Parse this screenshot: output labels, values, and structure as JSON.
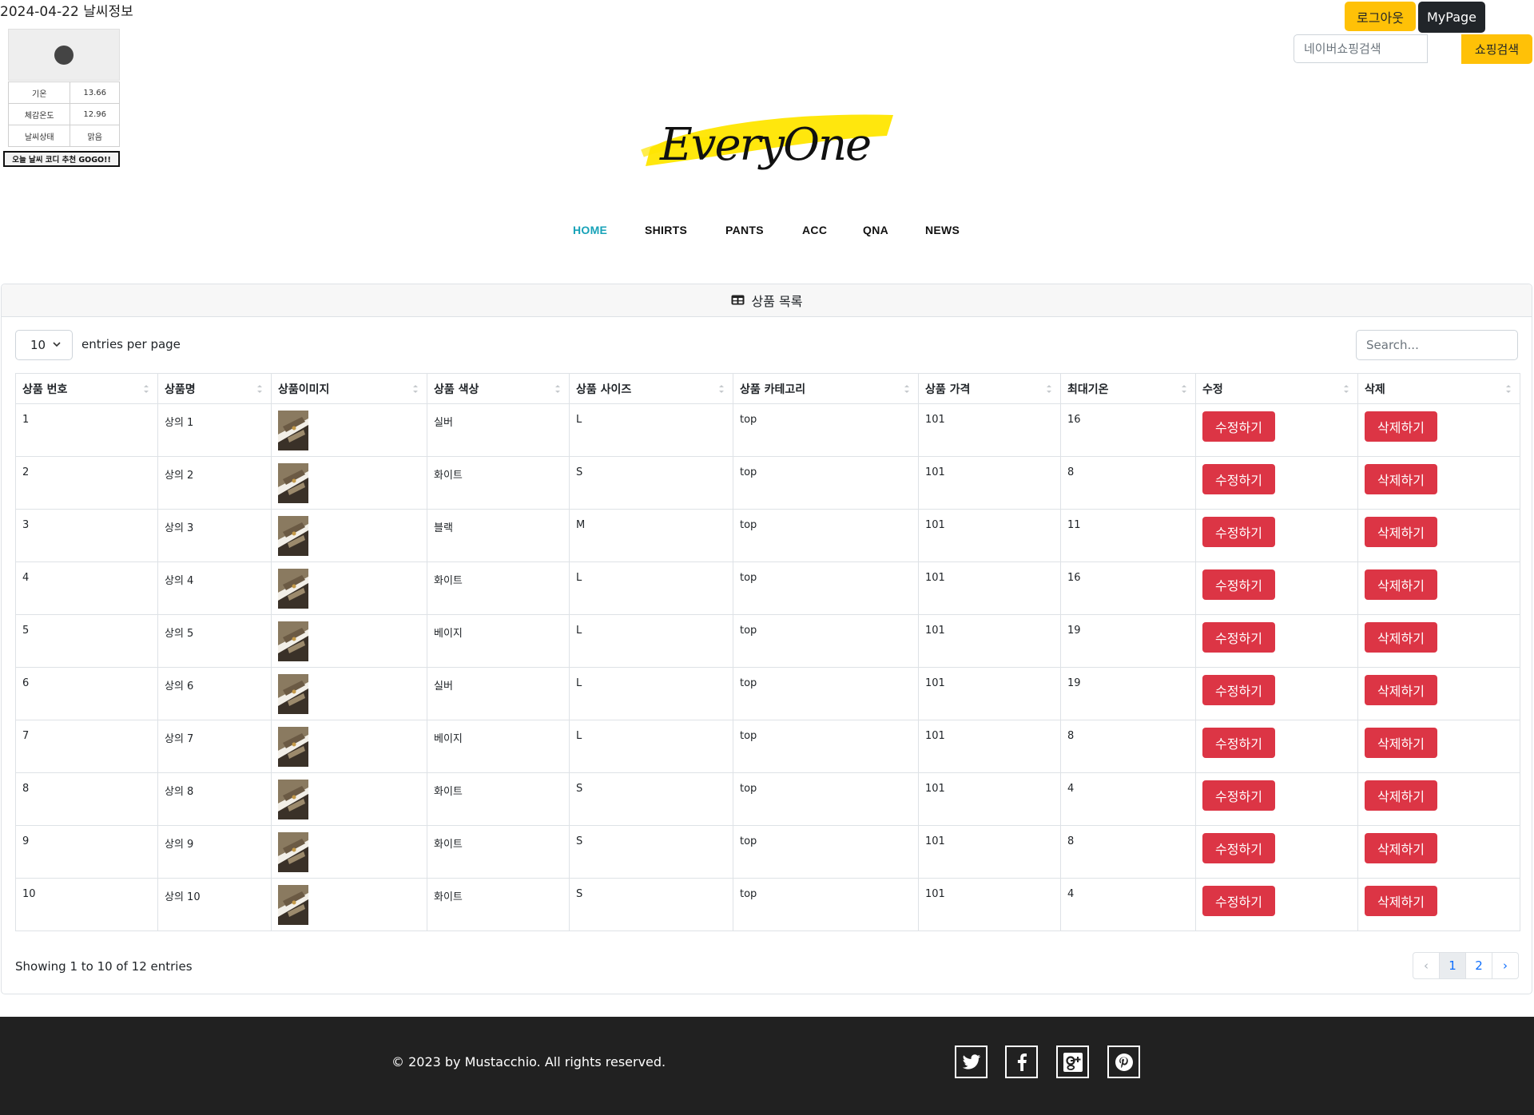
{
  "weather": {
    "date": "2024-04-22",
    "title": "날씨정보",
    "icon": "weather-dot-icon",
    "rows": [
      {
        "label": "기온",
        "value": "13.66"
      },
      {
        "label": "체감온도",
        "value": "12.96"
      },
      {
        "label": "날씨상태",
        "value": "맑음"
      }
    ],
    "button_label": "오늘 날씨 코디 추천 GOGO!!"
  },
  "header": {
    "logout_label": "로그아웃",
    "mypage_label": "MyPage",
    "shop_search_placeholder": "네이버쇼핑검색",
    "shop_search_button": "쇼핑검색",
    "logo_text": "EveryOne"
  },
  "nav": {
    "items": [
      {
        "label": "HOME",
        "active": true
      },
      {
        "label": "SHIRTS",
        "active": false
      },
      {
        "label": "PANTS",
        "active": false
      },
      {
        "label": "ACC",
        "active": false
      },
      {
        "label": "QNA",
        "active": false
      },
      {
        "label": "NEWS",
        "active": false
      }
    ]
  },
  "card": {
    "title": "상품 목록",
    "per_page_value": "10",
    "per_page_label": "entries per page",
    "search_placeholder": "Search..."
  },
  "table": {
    "columns": [
      "상품 번호",
      "상품명",
      "상품이미지",
      "상품 색상",
      "상품 사이즈",
      "상품 카테고리",
      "상품 가격",
      "최대기온",
      "수정",
      "삭제"
    ],
    "edit_label": "수정하기",
    "delete_label": "삭제하기",
    "rows": [
      {
        "id": "1",
        "name": "상의 1",
        "color": "실버",
        "size": "L",
        "category": "top",
        "price": "101",
        "max_temp": "16"
      },
      {
        "id": "2",
        "name": "상의 2",
        "color": "화이트",
        "size": "S",
        "category": "top",
        "price": "101",
        "max_temp": "8"
      },
      {
        "id": "3",
        "name": "상의 3",
        "color": "블랙",
        "size": "M",
        "category": "top",
        "price": "101",
        "max_temp": "11"
      },
      {
        "id": "4",
        "name": "상의 4",
        "color": "화이트",
        "size": "L",
        "category": "top",
        "price": "101",
        "max_temp": "16"
      },
      {
        "id": "5",
        "name": "상의 5",
        "color": "베이지",
        "size": "L",
        "category": "top",
        "price": "101",
        "max_temp": "19"
      },
      {
        "id": "6",
        "name": "상의 6",
        "color": "실버",
        "size": "L",
        "category": "top",
        "price": "101",
        "max_temp": "19"
      },
      {
        "id": "7",
        "name": "상의 7",
        "color": "베이지",
        "size": "L",
        "category": "top",
        "price": "101",
        "max_temp": "8"
      },
      {
        "id": "8",
        "name": "상의 8",
        "color": "화이트",
        "size": "S",
        "category": "top",
        "price": "101",
        "max_temp": "4"
      },
      {
        "id": "9",
        "name": "상의 9",
        "color": "화이트",
        "size": "S",
        "category": "top",
        "price": "101",
        "max_temp": "8"
      },
      {
        "id": "10",
        "name": "상의 10",
        "color": "화이트",
        "size": "S",
        "category": "top",
        "price": "101",
        "max_temp": "4"
      }
    ]
  },
  "pagination": {
    "info": "Showing 1 to 10 of 12 entries",
    "prev": "‹",
    "pages": [
      "1",
      "2"
    ],
    "current": "1",
    "next": "›"
  },
  "footer": {
    "copyright": "© 2023 by Mustacchio. All rights reserved.",
    "social": [
      "twitter-icon",
      "facebook-icon",
      "google-plus-icon",
      "pinterest-icon"
    ]
  },
  "colors": {
    "accent_yellow": "#ffc107",
    "danger_red": "#dc3545",
    "nav_active": "#17a2b8",
    "footer_bg": "#212121"
  }
}
